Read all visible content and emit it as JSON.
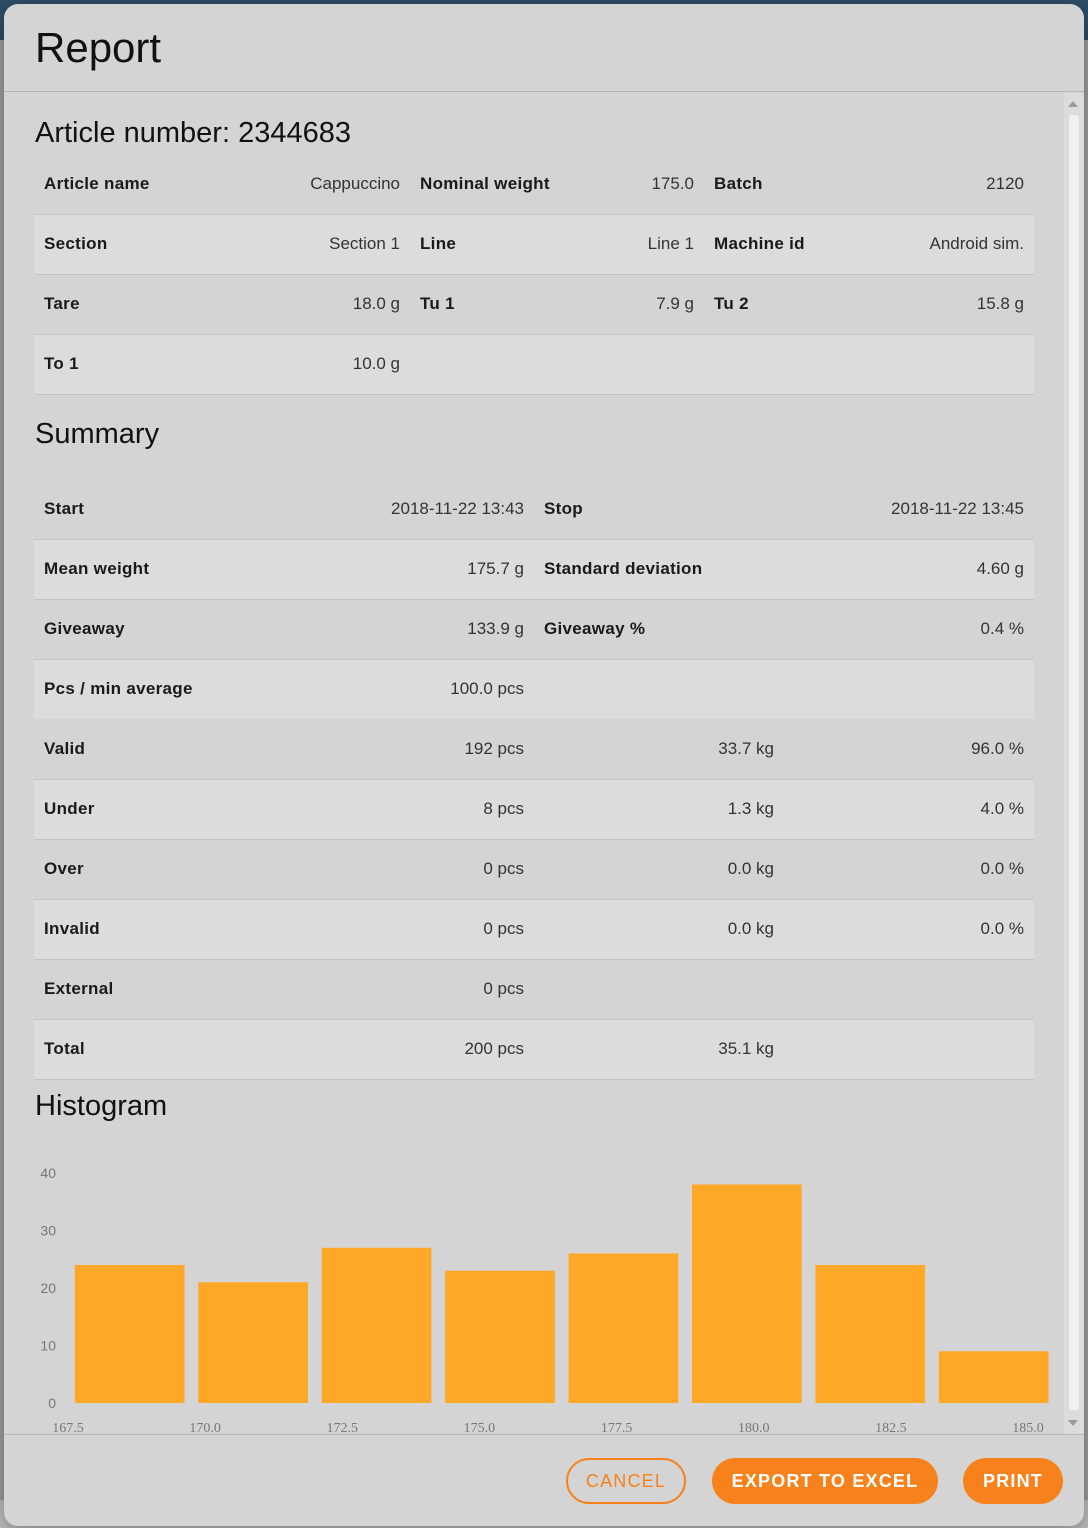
{
  "dialog": {
    "title": "Report"
  },
  "article": {
    "heading": "Article number: 2344683",
    "rows": [
      [
        [
          "Article name",
          "Cappuccino"
        ],
        [
          "Nominal weight",
          "175.0"
        ],
        [
          "Batch",
          "2120"
        ]
      ],
      [
        [
          "Section",
          "Section 1"
        ],
        [
          "Line",
          "Line 1"
        ],
        [
          "Machine id",
          "Android sim."
        ]
      ],
      [
        [
          "Tare",
          "18.0 g"
        ],
        [
          "Tu 1",
          "7.9 g"
        ],
        [
          "Tu 2",
          "15.8 g"
        ]
      ],
      [
        [
          "To 1",
          "10.0 g"
        ],
        [
          "",
          ""
        ],
        [
          "",
          ""
        ]
      ]
    ]
  },
  "summary": {
    "heading": "Summary",
    "pair_rows": [
      [
        [
          "Start",
          "2018-11-22 13:43"
        ],
        [
          "Stop",
          "2018-11-22 13:45"
        ]
      ],
      [
        [
          "Mean weight",
          "175.7 g"
        ],
        [
          "Standard deviation",
          "4.60 g"
        ]
      ],
      [
        [
          "Giveaway",
          "133.9 g"
        ],
        [
          "Giveaway %",
          "0.4 %"
        ]
      ],
      [
        [
          "Pcs / min average",
          "100.0 pcs"
        ],
        [
          "",
          ""
        ]
      ]
    ],
    "count_rows": [
      [
        "Valid",
        "192 pcs",
        "33.7 kg",
        "96.0 %"
      ],
      [
        "Under",
        "8 pcs",
        "1.3 kg",
        "4.0 %"
      ],
      [
        "Over",
        "0 pcs",
        "0.0 kg",
        "0.0 %"
      ],
      [
        "Invalid",
        "0 pcs",
        "0.0 kg",
        "0.0 %"
      ],
      [
        "External",
        "0 pcs",
        "",
        ""
      ],
      [
        "Total",
        "200 pcs",
        "35.1 kg",
        ""
      ]
    ]
  },
  "histogram": {
    "heading": "Histogram"
  },
  "chart_data": {
    "type": "bar",
    "x_ticks": [
      "167.5",
      "170.0",
      "172.5",
      "175.0",
      "177.5",
      "180.0",
      "182.5",
      "185.0"
    ],
    "x_range": [
      167.5,
      185.0
    ],
    "bin_edges": [
      167.5,
      169.75,
      172.0,
      174.25,
      176.5,
      178.75,
      181.0,
      183.25
    ],
    "values": [
      24,
      21,
      27,
      23,
      26,
      38,
      24,
      9
    ],
    "y_ticks": [
      "0",
      "10",
      "20",
      "30",
      "40"
    ],
    "ylim": [
      0,
      40
    ],
    "bar_color": "#ffa726",
    "grid": false
  },
  "footer": {
    "cancel_label": "CANCEL",
    "export_label": "EXPORT TO EXCEL",
    "print_label": "PRINT"
  },
  "colors": {
    "accent": "#f7821b"
  }
}
